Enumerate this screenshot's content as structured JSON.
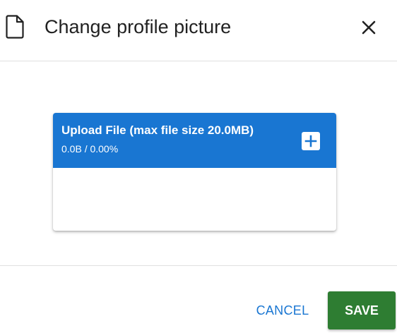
{
  "dialog": {
    "title": "Change profile picture",
    "header_icon": "file-icon",
    "close_icon": "close-icon"
  },
  "upload": {
    "title": "Upload File (max file size 20.0MB)",
    "progress": "0.0B / 0.00%",
    "add_icon": "plus-icon",
    "accent_color": "#1976d2"
  },
  "actions": {
    "cancel_label": "CANCEL",
    "save_label": "SAVE",
    "save_color": "#2e7d32"
  }
}
